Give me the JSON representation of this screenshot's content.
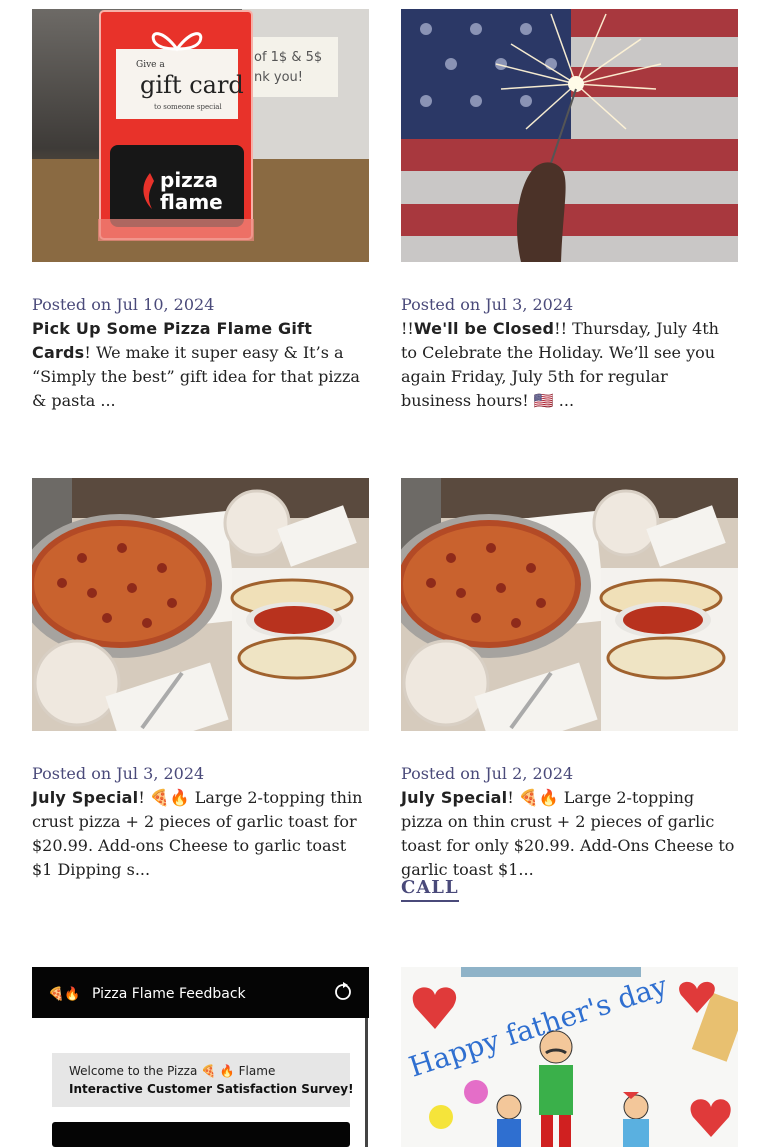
{
  "posts": [
    {
      "date": "Posted on Jul 10, 2024",
      "title": "Pick Up Some Pizza Flame Gift Cards",
      "after_title": "!",
      "body": "We make it super easy & It’s a “Simply the best” gift idea for that pizza & pasta ...",
      "image": {
        "subject": "gift-card-stand",
        "card_top": "Give a",
        "card_main": "gift card",
        "card_sub": "to someone special",
        "brand_1": "pizza",
        "brand_2": "flame",
        "note_1": "of 1$ & 5$",
        "note_2": "nk you!"
      }
    },
    {
      "date": "Posted on Jul 3, 2024",
      "before_title": "!!",
      "title": "We'll be Closed",
      "after_title": "!! Thursday, July 4th to",
      "body": "Celebrate the Holiday. We’ll see you again Friday, July 5th for regular business hours! 🇺🇸 ...",
      "image": {
        "subject": "sparkler-flag"
      }
    },
    {
      "date": "Posted on Jul 3, 2024",
      "icon": "",
      "title": "July Special",
      "after_title": "! 🍕🔥 Large 2-topping thin crust",
      "body": "pizza + 2 pieces of garlic toast for $20.99. Add-ons Cheese to garlic toast $1 Dipping s...",
      "image": {
        "subject": "pizza-table"
      }
    },
    {
      "date": "Posted on Jul 2, 2024",
      "icon": "",
      "title": "July Special",
      "after_title": "! 🍕🔥 Large 2-topping pizza on",
      "body": "thin crust + 2 pieces of garlic toast for only $20.99. Add-Ons Cheese to garlic toast $1...",
      "image": {
        "subject": "pizza-table"
      }
    },
    {
      "image": {
        "subject": "feedback-app",
        "app_title": "Pizza Flame Feedback",
        "app_emoji": "🍕🔥",
        "welcome_1": "Welcome to the Pizza 🍕 🔥 Flame",
        "welcome_2": "Interactive Customer Satisfaction Survey!"
      }
    },
    {
      "image": {
        "subject": "fathers-day-drawing",
        "caption": "Happy father's day"
      }
    }
  ],
  "call_link": "CALL",
  "colors": {
    "meta": "#4a4a7a",
    "text": "#222222",
    "brand_red": "#e8322a"
  }
}
